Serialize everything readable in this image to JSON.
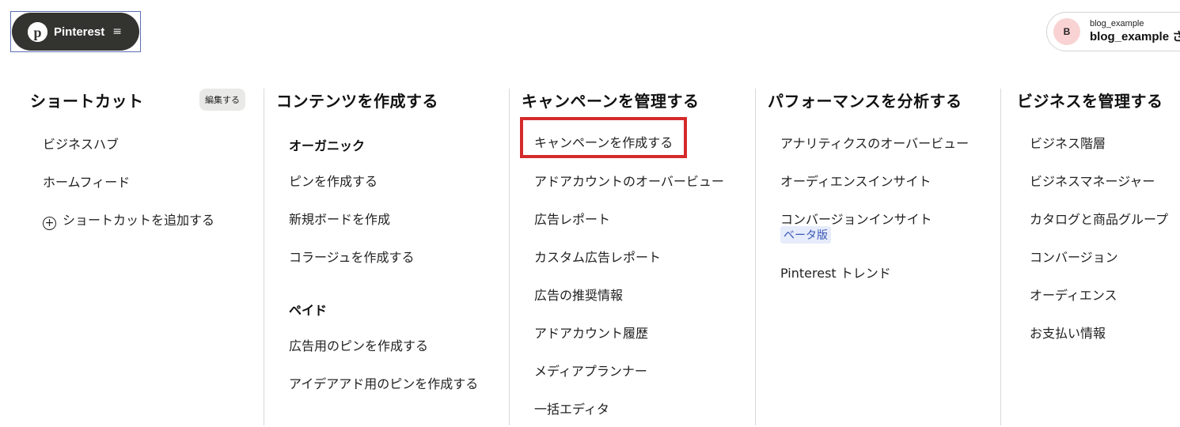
{
  "header": {
    "brand_label": "Pinterest",
    "account_small": "blog_example",
    "account_name": "blog_example さ",
    "avatar_initial": "B"
  },
  "columns": {
    "shortcuts": {
      "title": "ショートカット",
      "edit_label": "編集する",
      "items": [
        "ビジネスハブ",
        "ホームフィード",
        "ショートカットを追加する"
      ]
    },
    "create": {
      "title": "コンテンツを作成する",
      "organic_heading": "オーガニック",
      "organic_items": [
        "ピンを作成する",
        "新規ボードを作成",
        "コラージュを作成する"
      ],
      "paid_heading": "ペイド",
      "paid_items": [
        "広告用のピンを作成する",
        "アイデアアド用のピンを作成する"
      ]
    },
    "campaigns": {
      "title": "キャンペーンを管理する",
      "items": [
        "キャンペーンを作成する",
        "アドアカウントのオーバービュー",
        "広告レポート",
        "カスタム広告レポート",
        "広告の推奨情報",
        "アドアカウント履歴",
        "メディアプランナー",
        "一括エディタ"
      ]
    },
    "analytics": {
      "title": "パフォーマンスを分析する",
      "items": [
        "アナリティクスのオーバービュー",
        "オーディエンスインサイト",
        "コンバージョンインサイト",
        "Pinterest トレンド"
      ],
      "beta_badge": "ベータ版"
    },
    "business": {
      "title": "ビジネスを管理する",
      "items": [
        "ビジネス階層",
        "ビジネスマネージャー",
        "カタログと商品グループ",
        "コンバージョン",
        "オーディエンス",
        "お支払い情報"
      ]
    }
  },
  "colors": {
    "brand_button": "#33332f",
    "highlight_border": "#d42a2a",
    "beta_badge_bg": "#e6ecfb",
    "avatar_bg": "#f9d3d3"
  }
}
